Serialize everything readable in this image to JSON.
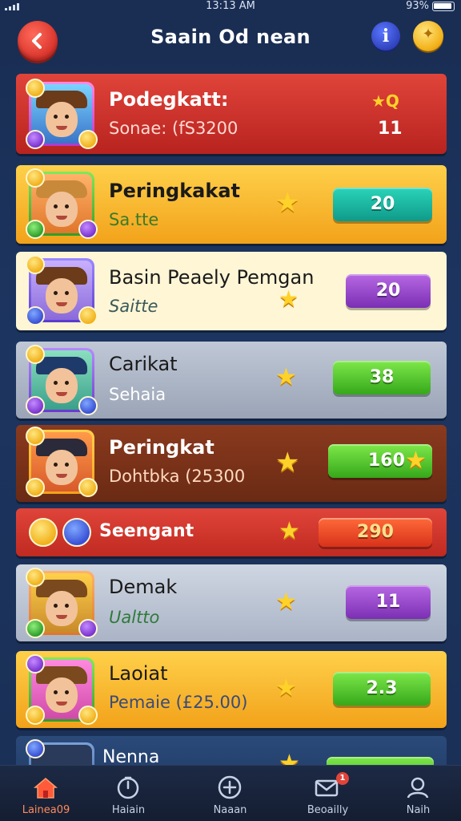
{
  "status_bar": {
    "time": "13:13 AM",
    "battery": "93%"
  },
  "header": {
    "title": "Saain Od nean",
    "info_label": "i"
  },
  "ranks": [
    {
      "name": "Podegkatt:",
      "sub": "Sonae: (fS3200",
      "score": "11",
      "star_label": "★Q",
      "theme": "red"
    },
    {
      "name": "Peringkakat",
      "sub": "Sa.tte",
      "score": "20",
      "theme": "orange"
    },
    {
      "name": "Basin Peaely Pemgan",
      "sub": "Saitte",
      "score": "20",
      "theme": "cream"
    },
    {
      "name": "Carikat",
      "sub": "Sehaia",
      "score": "38",
      "theme": "gray"
    },
    {
      "name": "Peringkat",
      "sub": "Dohtbka (25300",
      "score": "160",
      "theme": "brown"
    },
    {
      "name": "Seengant",
      "sub": "",
      "score": "290",
      "theme": "redslim"
    },
    {
      "name": "Demak",
      "sub": "Ualtto",
      "score": "11",
      "theme": "gray"
    },
    {
      "name": "Laoiat",
      "sub": "Pemaie (£25.00)",
      "score": "2.3",
      "theme": "orange"
    },
    {
      "name": "Nenna",
      "sub": "",
      "score": "",
      "theme": "navy"
    }
  ],
  "bottom_nav": [
    {
      "label": "Lainea09",
      "icon": "home-icon"
    },
    {
      "label": "Haiain",
      "icon": "timer-icon"
    },
    {
      "label": "Naaan",
      "icon": "plus-circle-icon"
    },
    {
      "label": "Beoailly",
      "icon": "mail-icon",
      "badge": "1"
    },
    {
      "label": "Naih",
      "icon": "profile-icon"
    }
  ]
}
